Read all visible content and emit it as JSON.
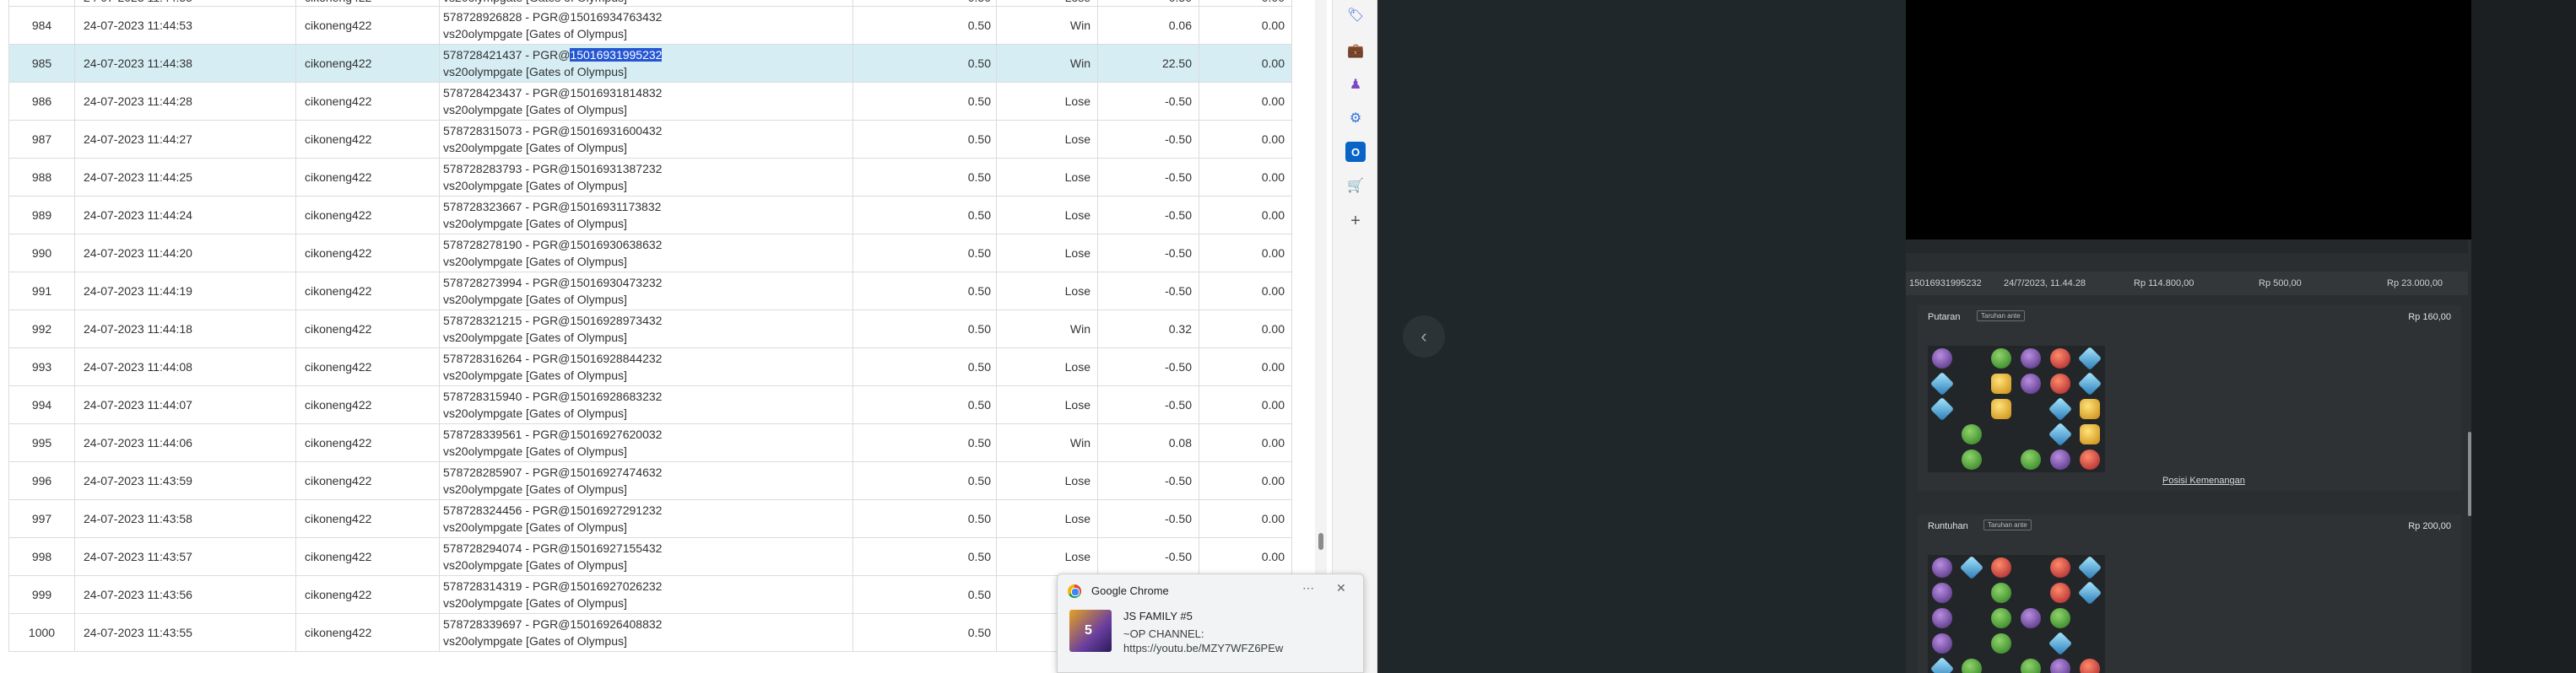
{
  "table": {
    "rows": [
      {
        "no": "984",
        "date": "24-07-2023 11:44:53",
        "user": "cikoneng422",
        "line1": "578728926828 - PGR@15016934763432",
        "line2": "vs20olympgate [Gates of Olympus]",
        "bet": "0.50",
        "result": "Win",
        "amount": "0.06",
        "balance": "0.00"
      },
      {
        "no": "985",
        "date": "24-07-2023 11:44:38",
        "user": "cikoneng422",
        "line1a": "578728421437 - PGR@",
        "line1b": "15016931995232",
        "line2": "vs20olympgate [Gates of Olympus]",
        "bet": "0.50",
        "result": "Win",
        "amount": "22.50",
        "balance": "0.00"
      },
      {
        "no": "986",
        "date": "24-07-2023 11:44:28",
        "user": "cikoneng422",
        "line1": "578728423437 - PGR@15016931814832",
        "line2": "vs20olympgate [Gates of Olympus]",
        "bet": "0.50",
        "result": "Lose",
        "amount": "-0.50",
        "balance": "0.00"
      },
      {
        "no": "987",
        "date": "24-07-2023 11:44:27",
        "user": "cikoneng422",
        "line1": "578728315073 - PGR@15016931600432",
        "line2": "vs20olympgate [Gates of Olympus]",
        "bet": "0.50",
        "result": "Lose",
        "amount": "-0.50",
        "balance": "0.00"
      },
      {
        "no": "988",
        "date": "24-07-2023 11:44:25",
        "user": "cikoneng422",
        "line1": "578728283793 - PGR@15016931387232",
        "line2": "vs20olympgate [Gates of Olympus]",
        "bet": "0.50",
        "result": "Lose",
        "amount": "-0.50",
        "balance": "0.00"
      },
      {
        "no": "989",
        "date": "24-07-2023 11:44:24",
        "user": "cikoneng422",
        "line1": "578728323667 - PGR@15016931173832",
        "line2": "vs20olympgate [Gates of Olympus]",
        "bet": "0.50",
        "result": "Lose",
        "amount": "-0.50",
        "balance": "0.00"
      },
      {
        "no": "990",
        "date": "24-07-2023 11:44:20",
        "user": "cikoneng422",
        "line1": "578728278190 - PGR@15016930638632",
        "line2": "vs20olympgate [Gates of Olympus]",
        "bet": "0.50",
        "result": "Lose",
        "amount": "-0.50",
        "balance": "0.00"
      },
      {
        "no": "991",
        "date": "24-07-2023 11:44:19",
        "user": "cikoneng422",
        "line1": "578728273994 - PGR@15016930473232",
        "line2": "vs20olympgate [Gates of Olympus]",
        "bet": "0.50",
        "result": "Lose",
        "amount": "-0.50",
        "balance": "0.00"
      },
      {
        "no": "992",
        "date": "24-07-2023 11:44:18",
        "user": "cikoneng422",
        "line1": "578728321215 - PGR@15016928973432",
        "line2": "vs20olympgate [Gates of Olympus]",
        "bet": "0.50",
        "result": "Win",
        "amount": "0.32",
        "balance": "0.00"
      },
      {
        "no": "993",
        "date": "24-07-2023 11:44:08",
        "user": "cikoneng422",
        "line1": "578728316264 - PGR@15016928844232",
        "line2": "vs20olympgate [Gates of Olympus]",
        "bet": "0.50",
        "result": "Lose",
        "amount": "-0.50",
        "balance": "0.00"
      },
      {
        "no": "994",
        "date": "24-07-2023 11:44:07",
        "user": "cikoneng422",
        "line1": "578728315940 - PGR@15016928683232",
        "line2": "vs20olympgate [Gates of Olympus]",
        "bet": "0.50",
        "result": "Lose",
        "amount": "-0.50",
        "balance": "0.00"
      },
      {
        "no": "995",
        "date": "24-07-2023 11:44:06",
        "user": "cikoneng422",
        "line1": "578728339561 - PGR@15016927620032",
        "line2": "vs20olympgate [Gates of Olympus]",
        "bet": "0.50",
        "result": "Win",
        "amount": "0.08",
        "balance": "0.00"
      },
      {
        "no": "996",
        "date": "24-07-2023 11:43:59",
        "user": "cikoneng422",
        "line1": "578728285907 - PGR@15016927474632",
        "line2": "vs20olympgate [Gates of Olympus]",
        "bet": "0.50",
        "result": "Lose",
        "amount": "-0.50",
        "balance": "0.00"
      },
      {
        "no": "997",
        "date": "24-07-2023 11:43:58",
        "user": "cikoneng422",
        "line1": "578728324456 - PGR@15016927291232",
        "line2": "vs20olympgate [Gates of Olympus]",
        "bet": "0.50",
        "result": "Lose",
        "amount": "-0.50",
        "balance": "0.00"
      },
      {
        "no": "998",
        "date": "24-07-2023 11:43:57",
        "user": "cikoneng422",
        "line1": "578728294074 - PGR@15016927155432",
        "line2": "vs20olympgate [Gates of Olympus]",
        "bet": "0.50",
        "result": "Lose",
        "amount": "-0.50",
        "balance": "0.00"
      },
      {
        "no": "999",
        "date": "24-07-2023 11:43:56",
        "user": "cikoneng422",
        "line1": "578728314319 - PGR@15016927026232",
        "line2": "vs20olympgate [Gates of Olympus]",
        "bet": "0.50",
        "result": "Lose",
        "amount": "-0.50",
        "balance": "0.00"
      },
      {
        "no": "1000",
        "date": "24-07-2023 11:43:55",
        "user": "cikoneng422",
        "line1": "578728339697 - PGR@15016926408832",
        "line2": "vs20olympgate [Gates of Olympus]",
        "bet": "0.50",
        "result": "Lose",
        "amount": "-0.50",
        "balance": "0.00"
      }
    ]
  },
  "history": {
    "summary": {
      "id": "15016931995232",
      "date": "24/7/2023, 11.44.28",
      "total_bet": "Rp 114.800,00",
      "bet": "Rp 500,00",
      "win": "Rp 23.000,00"
    },
    "spin_card": {
      "title": "Putaran",
      "badge": "Taruhan ante",
      "amount": "Rp 160,00",
      "link": "Posisi Kemenangan"
    },
    "tumble_card": {
      "title": "Runtuhan",
      "badge": "Taruhan ante",
      "amount": "Rp 200,00"
    }
  },
  "notification": {
    "app": "Google Chrome",
    "title": "JS FAMILY #5",
    "body": "~OP CHANNEL: https://youtu.be/MZY7WFZ6PEw",
    "more_icon": "⋯",
    "close_icon": "✕"
  },
  "sidebar_icons": [
    "tag-icon",
    "briefcase-icon",
    "games-icon",
    "settings-gear-icon",
    "outlook-icon",
    "shopping-cart-icon",
    "plus-icon"
  ],
  "colors": {
    "win": "#1a9a2a",
    "lose": "#e02020",
    "selected_row": "#d6edf3"
  }
}
